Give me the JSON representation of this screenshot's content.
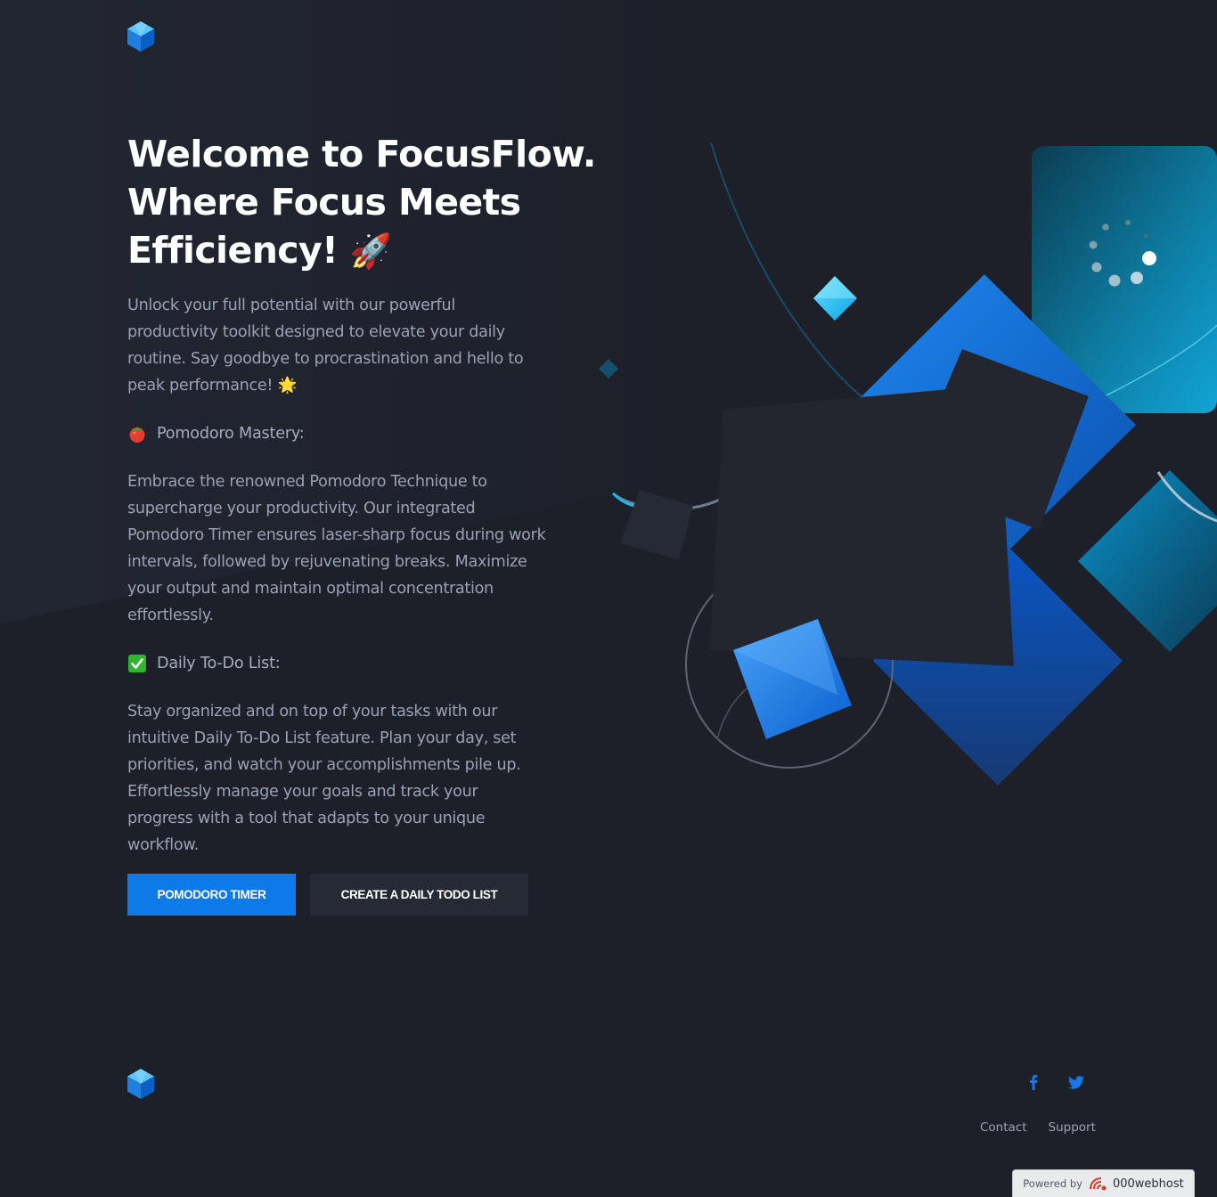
{
  "header": {
    "logo": "cube-logo"
  },
  "hero": {
    "title_line1": "Welcome to FocusFlow.",
    "title_line2": "Where Focus Meets",
    "title_line3": "Efficiency!",
    "title_emoji": "🚀",
    "intro": "Unlock your full potential with our powerful productivity toolkit designed to elevate your daily routine. Say goodbye to procrastination and hello to peak performance! 🌟",
    "features": [
      {
        "icon": "tomato-icon",
        "title": "Pomodoro Mastery:",
        "body": "Embrace the renowned Pomodoro Technique to supercharge your productivity. Our integrated Pomodoro Timer ensures laser-sharp focus during work intervals, followed by rejuvenating breaks. Maximize your output and maintain optimal concentration effortlessly."
      },
      {
        "icon": "check-mark-icon",
        "title": "Daily To-Do List:",
        "body": "Stay organized and on top of your tasks with our intuitive Daily To-Do List feature. Plan your day, set priorities, and watch your accomplishments pile up. Effortlessly manage your goals and track your progress with a tool that adapts to your unique workflow."
      }
    ]
  },
  "buttons": {
    "primary_label": "POMODORO TIMER",
    "secondary_label": "CREATE A DAILY TODO LIST"
  },
  "footer": {
    "social": [
      "facebook-icon",
      "twitter-icon"
    ],
    "links": [
      "Contact",
      "Support"
    ]
  },
  "badge": {
    "powered_by": "Powered by",
    "brand": "000webhost"
  },
  "colors": {
    "background": "#1d2029",
    "accent": "#0e79e8",
    "secondary_button": "#262a34",
    "heading": "#ffffff",
    "body_text": "#99a1b3"
  }
}
